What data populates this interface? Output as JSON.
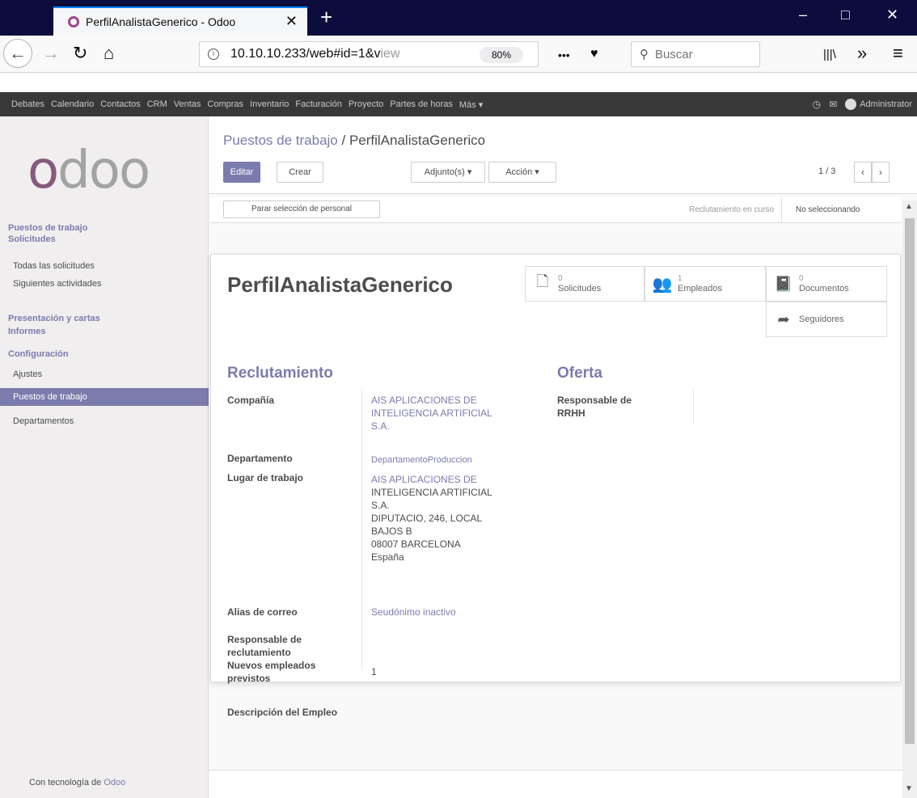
{
  "browser": {
    "tab_title": "PerfilAnalistaGenerico - Odoo",
    "new_tab": "+",
    "close_tab": "✕",
    "url_main": "10.10.10.233/web#id=1&v",
    "url_dim": "iew",
    "zoom": "80%",
    "page_actions": "•••",
    "search_placeholder": "Buscar",
    "library": "|||\\",
    "overflow": "»",
    "menu": "≡",
    "window_min": "–",
    "window_max": "□",
    "window_close": "✕"
  },
  "odoo_menu": {
    "items": [
      "Debates",
      "Calendario",
      "Contactos",
      "CRM",
      "Ventas",
      "Compras",
      "Inventario",
      "Facturación",
      "Proyecto",
      "Partes de horas",
      "Más ▾"
    ],
    "user": "Administrator"
  },
  "sidebar": {
    "logo": "odoo",
    "headings": [
      "Puestos de trabajo",
      "Solicitudes",
      "Presentación y cartas",
      "Informes",
      "Configuración"
    ],
    "items": [
      "Todas las solicitudes",
      "Siguientes actividades",
      "Ajustes",
      "Puestos de trabajo",
      "Departamentos"
    ],
    "active_item": "Puestos de trabajo",
    "powered_prefix": "Con tecnología de ",
    "powered_brand": "Odoo"
  },
  "control_panel": {
    "breadcrumb_parent": "Puestos de trabajo",
    "breadcrumb_sep": " / ",
    "breadcrumb_current": "PerfilAnalistaGenerico",
    "edit_button": "Editar",
    "create_button": "Crear",
    "attachments_button": "Adjunto(s) ▾",
    "action_button": "Acción ▾",
    "pager": "1 / 3",
    "prev": "‹",
    "next": "›"
  },
  "statusbar": {
    "stop_button": "Parar selección de personal",
    "stage_recruiting": "Reclutamiento en curso",
    "stage_not_recruiting": "No seleccionando"
  },
  "form": {
    "title": "PerfilAnalistaGenerico",
    "smart_buttons": {
      "solicitudes": {
        "count": "0",
        "label": "Solicitudes"
      },
      "empleados": {
        "count": "1",
        "label": "Empleados"
      },
      "documentos": {
        "count": "0",
        "label": "Documentos"
      },
      "seguidores": {
        "label": "Seguidores"
      }
    },
    "reclutamiento_title": "Reclutamiento",
    "oferta_title": "Oferta",
    "fields": {
      "compania_label": "Compañía",
      "compania_value": "AIS APLICACIONES DE\nINTELIGENCIA ARTIFICIAL\nS.A.",
      "departamento_label": "Departamento",
      "departamento_value": "DepartamentoProduccion",
      "lugar_label": "Lugar de trabajo",
      "lugar_link": "AIS APLICACIONES DE",
      "lugar_value": "INTELIGENCIA ARTIFICIAL\nS.A.\nDIPUTACIO, 246, LOCAL\nBAJOS B\n08007 BARCELONA\nEspaña",
      "alias_label": "Alias de correo",
      "alias_value": "Seudónimo inactivo",
      "resp_reclut_label": "Responsable de\nreclutamiento",
      "nuevos_label": "Nuevos empleados\nprevistos",
      "nuevos_value": "1",
      "descripcion_label": "Descripción del Empleo",
      "resp_rrhh_label": "Responsable de\nRRHH"
    }
  }
}
